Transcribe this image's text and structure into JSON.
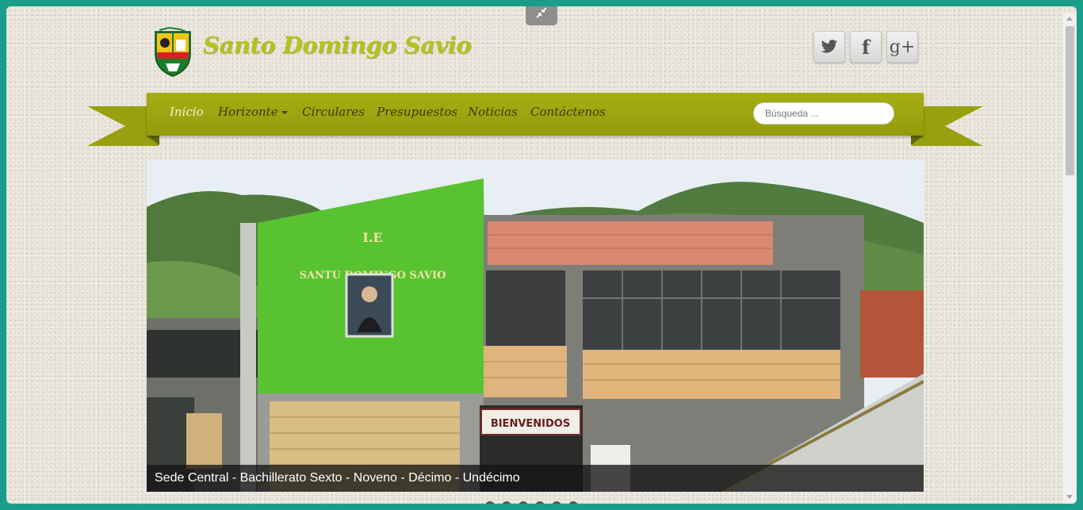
{
  "header": {
    "site_title": "Santo Domingo Savio",
    "logo_icon": "school-crest-icon",
    "social": [
      {
        "name": "twitter-icon",
        "label": "t"
      },
      {
        "name": "facebook-icon",
        "label": "f"
      },
      {
        "name": "google-plus-icon",
        "label": "g+"
      }
    ]
  },
  "nav": {
    "items": [
      {
        "label": "Inicio"
      },
      {
        "label": "Horizonte"
      },
      {
        "label": "Circulares"
      },
      {
        "label": "Presupuestos"
      },
      {
        "label": "Noticias"
      },
      {
        "label": "Contáctenos"
      }
    ],
    "search_placeholder": "Búsqueda ..."
  },
  "slider": {
    "caption": "Sede Central - Bachillerato Sexto - Noveno - Décimo - Undécimo",
    "building_sign_line1": "I.E",
    "building_sign_line2": "SANTU DOMINGO SAVIO",
    "welcome_sign": "BIENVENIDOS"
  },
  "colors": {
    "nav_green": "#9ba511",
    "title_green": "#b4c21b",
    "page_bg": "#ece9e0",
    "frame_teal": "#1a9e8a"
  }
}
